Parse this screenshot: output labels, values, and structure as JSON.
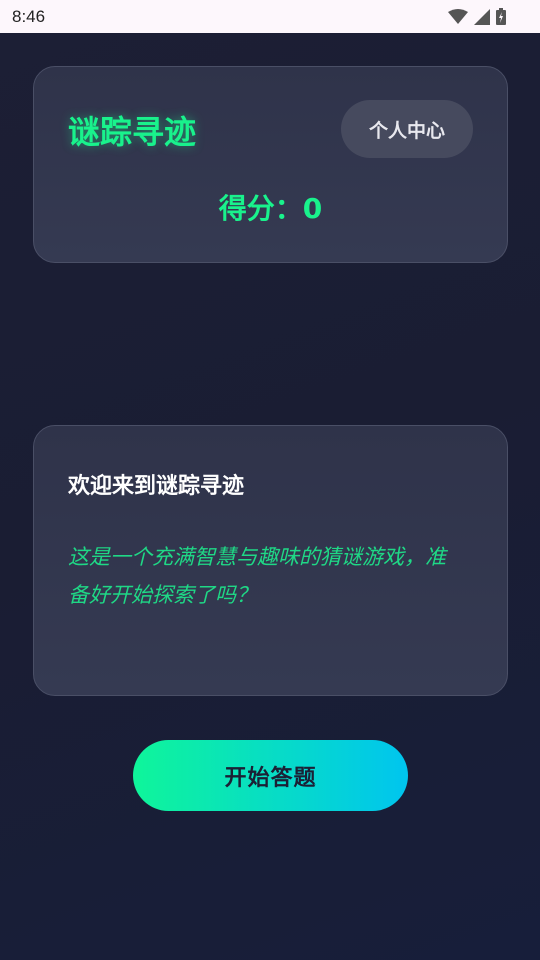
{
  "status_bar": {
    "time": "8:46",
    "icons": [
      "wifi-icon",
      "signal-icon",
      "battery-icon"
    ]
  },
  "header": {
    "app_title": "谜踪寻迹",
    "profile_button": "个人中心",
    "score_label": "得分：",
    "score_value": "0"
  },
  "welcome": {
    "title": "欢迎来到谜踪寻迹",
    "description": "这是一个充满智慧与趣味的猜谜游戏，准备好开始探索了吗？"
  },
  "actions": {
    "start_button": "开始答题"
  },
  "colors": {
    "accent_green": "#19f28c",
    "gradient_start": "#0ff59a",
    "gradient_end": "#00c5ef",
    "background": "#1c1f35",
    "card": "#33374e"
  }
}
